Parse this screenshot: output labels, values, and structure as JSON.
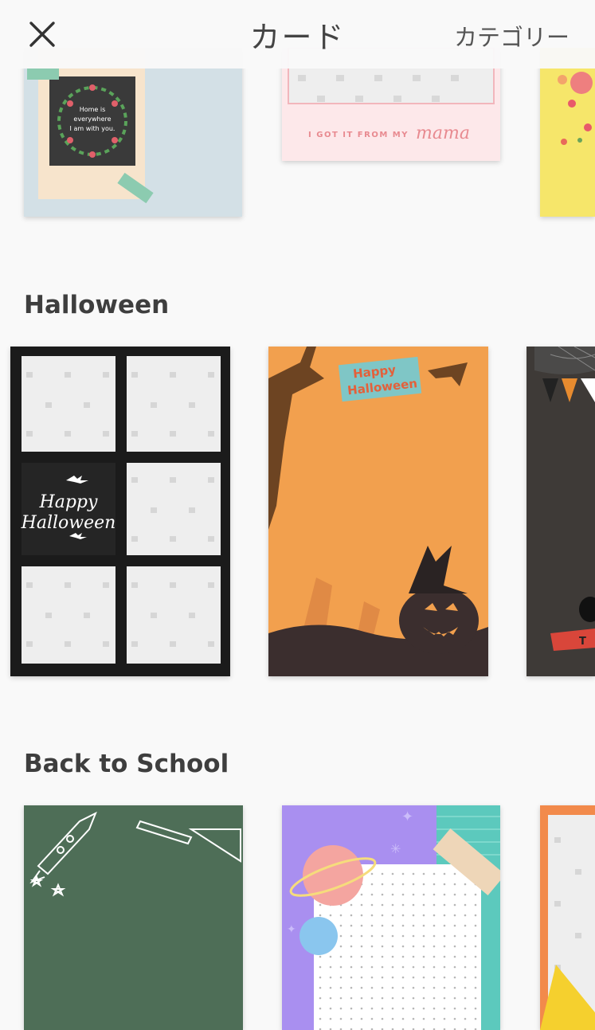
{
  "header": {
    "title": "カード",
    "category_link": "カテゴリー"
  },
  "sections": [
    {
      "title": "Halloween",
      "cards": [
        {
          "name": "happy-halloween-collage",
          "text": "Happy Halloween"
        },
        {
          "name": "happy-halloween-pumpkin",
          "text": "Happy Halloween"
        },
        {
          "name": "halloween-spider-card",
          "text": "T"
        }
      ]
    },
    {
      "title": "Back to School",
      "cards": [
        {
          "name": "chalkboard-card"
        },
        {
          "name": "space-notebook-card"
        },
        {
          "name": "orange-frame-card"
        }
      ]
    }
  ],
  "top_row": {
    "card1_text": "Home is everywhere I am with you.",
    "card2_text": "I GOT IT FROM MY",
    "card2_script": "mama"
  },
  "colors": {
    "background": "#f9f9f9",
    "halloween_orange": "#f2a04e",
    "chalkboard_green": "#4e6e57",
    "space_purple": "#a98ff0"
  }
}
